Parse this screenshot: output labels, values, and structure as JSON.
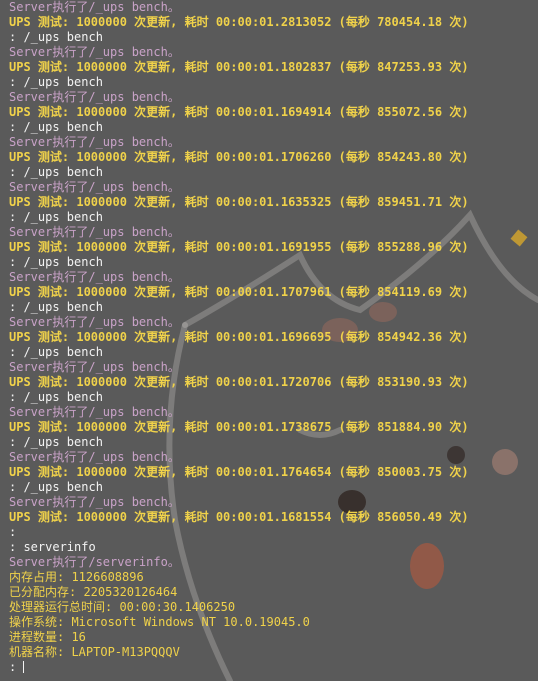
{
  "log": [
    {
      "text": "Server执行了/_ups bench。",
      "kind": "server"
    },
    {
      "text": "UPS 测试: 1000000 次更新, 耗时 00:00:01.2813052 (每秒 780454.18 次)",
      "kind": "ups"
    },
    {
      "text": ": /_ups bench",
      "kind": "prompt"
    },
    {
      "text": "Server执行了/_ups bench。",
      "kind": "server"
    },
    {
      "text": "UPS 测试: 1000000 次更新, 耗时 00:00:01.1802837 (每秒 847253.93 次)",
      "kind": "ups"
    },
    {
      "text": ": /_ups bench",
      "kind": "prompt"
    },
    {
      "text": "Server执行了/_ups bench。",
      "kind": "server"
    },
    {
      "text": "UPS 测试: 1000000 次更新, 耗时 00:00:01.1694914 (每秒 855072.56 次)",
      "kind": "ups"
    },
    {
      "text": ": /_ups bench",
      "kind": "prompt"
    },
    {
      "text": "Server执行了/_ups bench。",
      "kind": "server"
    },
    {
      "text": "UPS 测试: 1000000 次更新, 耗时 00:00:01.1706260 (每秒 854243.80 次)",
      "kind": "ups"
    },
    {
      "text": ": /_ups bench",
      "kind": "prompt"
    },
    {
      "text": "Server执行了/_ups bench。",
      "kind": "server"
    },
    {
      "text": "UPS 测试: 1000000 次更新, 耗时 00:00:01.1635325 (每秒 859451.71 次)",
      "kind": "ups"
    },
    {
      "text": ": /_ups bench",
      "kind": "prompt"
    },
    {
      "text": "Server执行了/_ups bench。",
      "kind": "server"
    },
    {
      "text": "UPS 测试: 1000000 次更新, 耗时 00:00:01.1691955 (每秒 855288.96 次)",
      "kind": "ups"
    },
    {
      "text": ": /_ups bench",
      "kind": "prompt"
    },
    {
      "text": "Server执行了/_ups bench。",
      "kind": "server"
    },
    {
      "text": "UPS 测试: 1000000 次更新, 耗时 00:00:01.1707961 (每秒 854119.69 次)",
      "kind": "ups"
    },
    {
      "text": ": /_ups bench",
      "kind": "prompt"
    },
    {
      "text": "Server执行了/_ups bench。",
      "kind": "server"
    },
    {
      "text": "UPS 测试: 1000000 次更新, 耗时 00:00:01.1696695 (每秒 854942.36 次)",
      "kind": "ups"
    },
    {
      "text": ": /_ups bench",
      "kind": "prompt"
    },
    {
      "text": "Server执行了/_ups bench。",
      "kind": "server"
    },
    {
      "text": "UPS 测试: 1000000 次更新, 耗时 00:00:01.1720706 (每秒 853190.93 次)",
      "kind": "ups"
    },
    {
      "text": ": /_ups bench",
      "kind": "prompt"
    },
    {
      "text": "Server执行了/_ups bench。",
      "kind": "server"
    },
    {
      "text": "UPS 测试: 1000000 次更新, 耗时 00:00:01.1738675 (每秒 851884.90 次)",
      "kind": "ups"
    },
    {
      "text": ": /_ups bench",
      "kind": "prompt"
    },
    {
      "text": "Server执行了/_ups bench。",
      "kind": "server"
    },
    {
      "text": "UPS 测试: 1000000 次更新, 耗时 00:00:01.1764654 (每秒 850003.75 次)",
      "kind": "ups"
    },
    {
      "text": ": /_ups bench",
      "kind": "prompt"
    },
    {
      "text": "Server执行了/_ups bench。",
      "kind": "server"
    },
    {
      "text": "UPS 测试: 1000000 次更新, 耗时 00:00:01.1681554 (每秒 856050.49 次)",
      "kind": "ups"
    },
    {
      "text": ":",
      "kind": "prompt"
    },
    {
      "text": ": serverinfo",
      "kind": "prompt"
    },
    {
      "text": "Server执行了/serverinfo。",
      "kind": "server"
    },
    {
      "text": "内存占用: 1126608896",
      "kind": "info"
    },
    {
      "text": "已分配内存: 2205320126464",
      "kind": "info"
    },
    {
      "text": "处理器运行总时间: 00:00:30.1406250",
      "kind": "info"
    },
    {
      "text": "操作系统: Microsoft Windows NT 10.0.19045.0",
      "kind": "info"
    },
    {
      "text": "进程数量: 16",
      "kind": "info"
    },
    {
      "text": "机器名称: LAPTOP-M13PQQQV",
      "kind": "info"
    }
  ],
  "input_prompt": ":",
  "colors": {
    "background": "#5a5a5a",
    "server": "#c9a2c8",
    "ups": "#f0d24a",
    "prompt": "#f3f3f3"
  },
  "background_art": "cat-face-watermark"
}
